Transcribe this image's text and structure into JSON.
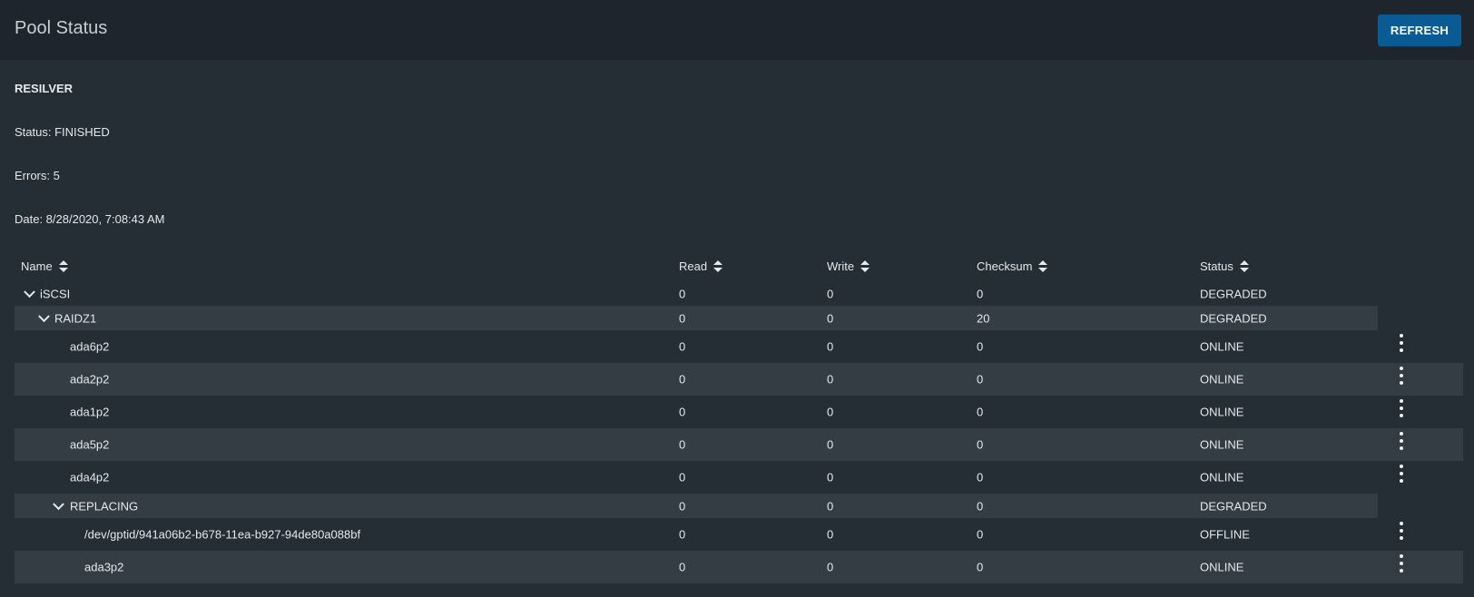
{
  "header": {
    "title": "Pool Status",
    "refresh_label": "REFRESH"
  },
  "scan": {
    "type": "RESILVER",
    "status": "Status: FINISHED",
    "errors": "Errors: 5",
    "date": "Date: 8/28/2020, 7:08:43 AM"
  },
  "table": {
    "columns": [
      "Name",
      "Read",
      "Write",
      "Checksum",
      "Status"
    ],
    "rows": [
      {
        "name": "iSCSI",
        "read": "0",
        "write": "0",
        "checksum": "0",
        "status": "DEGRADED"
      },
      {
        "name": "RAIDZ1",
        "read": "0",
        "write": "0",
        "checksum": "20",
        "status": "DEGRADED"
      },
      {
        "name": "ada6p2",
        "read": "0",
        "write": "0",
        "checksum": "0",
        "status": "ONLINE"
      },
      {
        "name": "ada2p2",
        "read": "0",
        "write": "0",
        "checksum": "0",
        "status": "ONLINE"
      },
      {
        "name": "ada1p2",
        "read": "0",
        "write": "0",
        "checksum": "0",
        "status": "ONLINE"
      },
      {
        "name": "ada5p2",
        "read": "0",
        "write": "0",
        "checksum": "0",
        "status": "ONLINE"
      },
      {
        "name": "ada4p2",
        "read": "0",
        "write": "0",
        "checksum": "0",
        "status": "ONLINE"
      },
      {
        "name": "REPLACING",
        "read": "0",
        "write": "0",
        "checksum": "0",
        "status": "DEGRADED"
      },
      {
        "name": "/dev/gptid/941a06b2-b678-11ea-b927-94de80a088bf",
        "read": "0",
        "write": "0",
        "checksum": "0",
        "status": "OFFLINE"
      },
      {
        "name": "ada3p2",
        "read": "0",
        "write": "0",
        "checksum": "0",
        "status": "ONLINE"
      }
    ]
  },
  "colors": {
    "background": "#252d35",
    "header": "#1e252c",
    "row_alt": "#343c44",
    "accent": "#0a5a93"
  },
  "icons": {
    "expand": "chevron-down-icon",
    "sort": "sort-icon",
    "menu": "more-vertical-icon"
  }
}
